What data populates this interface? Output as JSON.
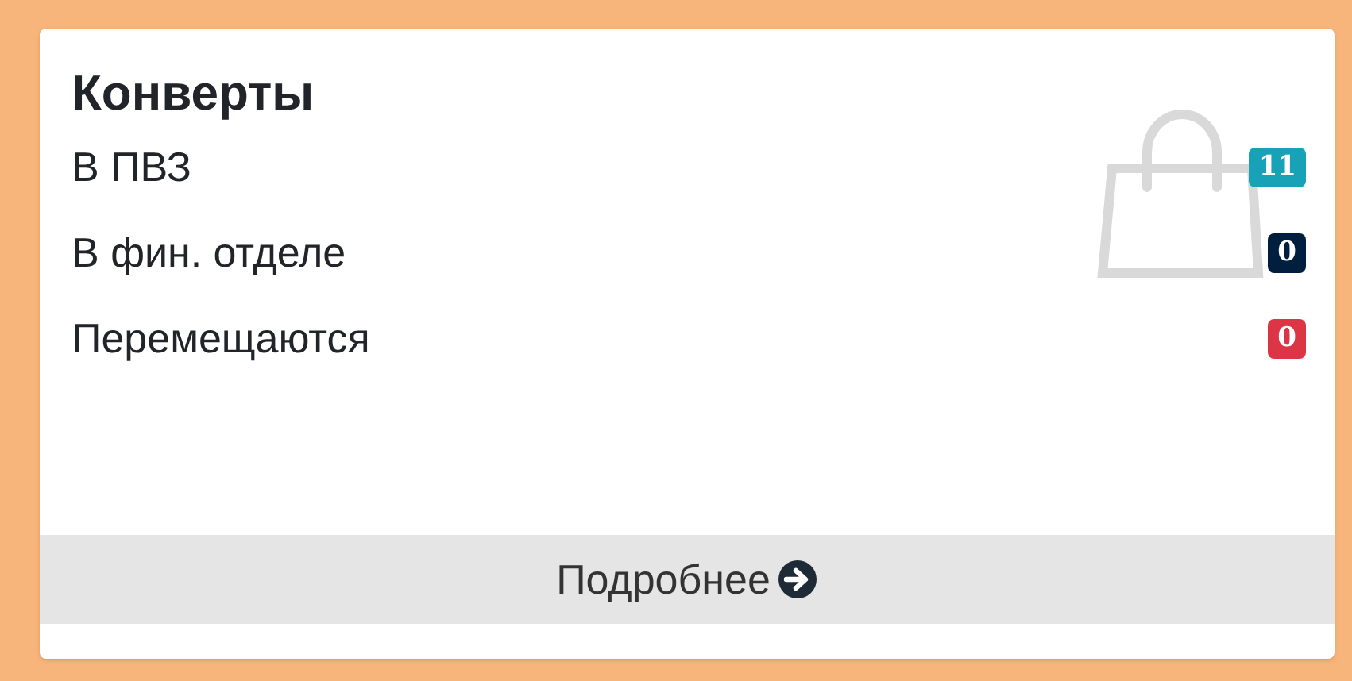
{
  "card": {
    "title": "Конверты",
    "rows": [
      {
        "label": "В ПВЗ",
        "count": "11",
        "color": "#17a2b8"
      },
      {
        "label": "В фин. отделе",
        "count": "0",
        "color": "#001f3f"
      },
      {
        "label": "Перемещаются",
        "count": "0",
        "color": "#dc3545"
      }
    ],
    "footer_link": "Подробнее"
  }
}
